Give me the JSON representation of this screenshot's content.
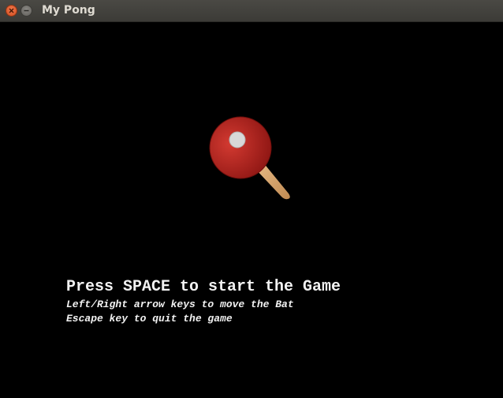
{
  "window": {
    "title": "My Pong"
  },
  "icons": {
    "close": "close-icon",
    "minimize": "minimize-icon",
    "paddle": "ping-pong-paddle-icon"
  },
  "colors": {
    "background": "#000000",
    "text": "#f2f2f2",
    "close_button": "#e05a2b",
    "paddle_red": "#b8211d",
    "paddle_handle": "#d9a874"
  },
  "menu": {
    "start_prompt": "Press SPACE to start the Game",
    "move_hint": "Left/Right arrow keys to move the Bat",
    "quit_hint": "Escape key to quit the game"
  }
}
